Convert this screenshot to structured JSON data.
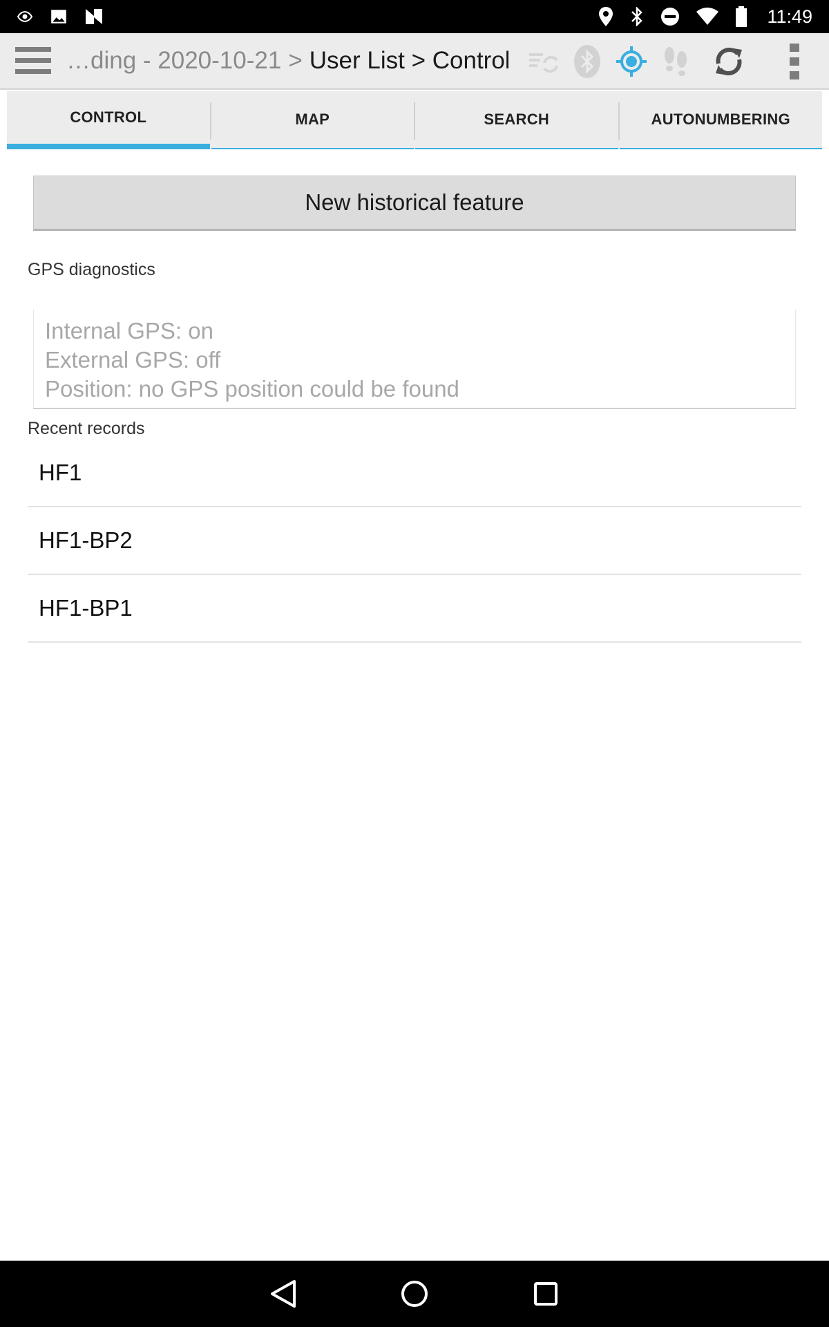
{
  "status_bar": {
    "time": "11:49",
    "left_icons": [
      "eye-notification-icon",
      "image-notification-icon",
      "n-notification-icon"
    ],
    "right_icons": [
      "location-pin-icon",
      "bluetooth-icon",
      "do-not-disturb-icon",
      "wifi-icon",
      "battery-icon"
    ]
  },
  "action_bar": {
    "breadcrumb_dim": "…ding - 2020-10-21",
    "breadcrumb_sep": ">",
    "breadcrumb_current": "User List > Control",
    "icons": [
      "sync-status-icon",
      "bluetooth-icon",
      "gps-icon",
      "footsteps-icon",
      "refresh-icon",
      "overflow-menu-icon"
    ],
    "accent_color": "#3aaee0"
  },
  "tabs": [
    {
      "label": "CONTROL",
      "active": true
    },
    {
      "label": "MAP",
      "active": false
    },
    {
      "label": "SEARCH",
      "active": false
    },
    {
      "label": "AUTONUMBERING",
      "active": false
    }
  ],
  "main": {
    "new_feature_label": "New historical feature",
    "gps_label": "GPS diagnostics",
    "gps_lines": [
      "Internal GPS: on",
      "External GPS: off",
      "Position: no GPS position could be found"
    ],
    "recent_label": "Recent records",
    "records": [
      "HF1",
      "HF1-BP2",
      "HF1-BP1"
    ]
  },
  "nav_bar": {
    "buttons": [
      "back-icon",
      "home-icon",
      "recents-icon"
    ]
  }
}
